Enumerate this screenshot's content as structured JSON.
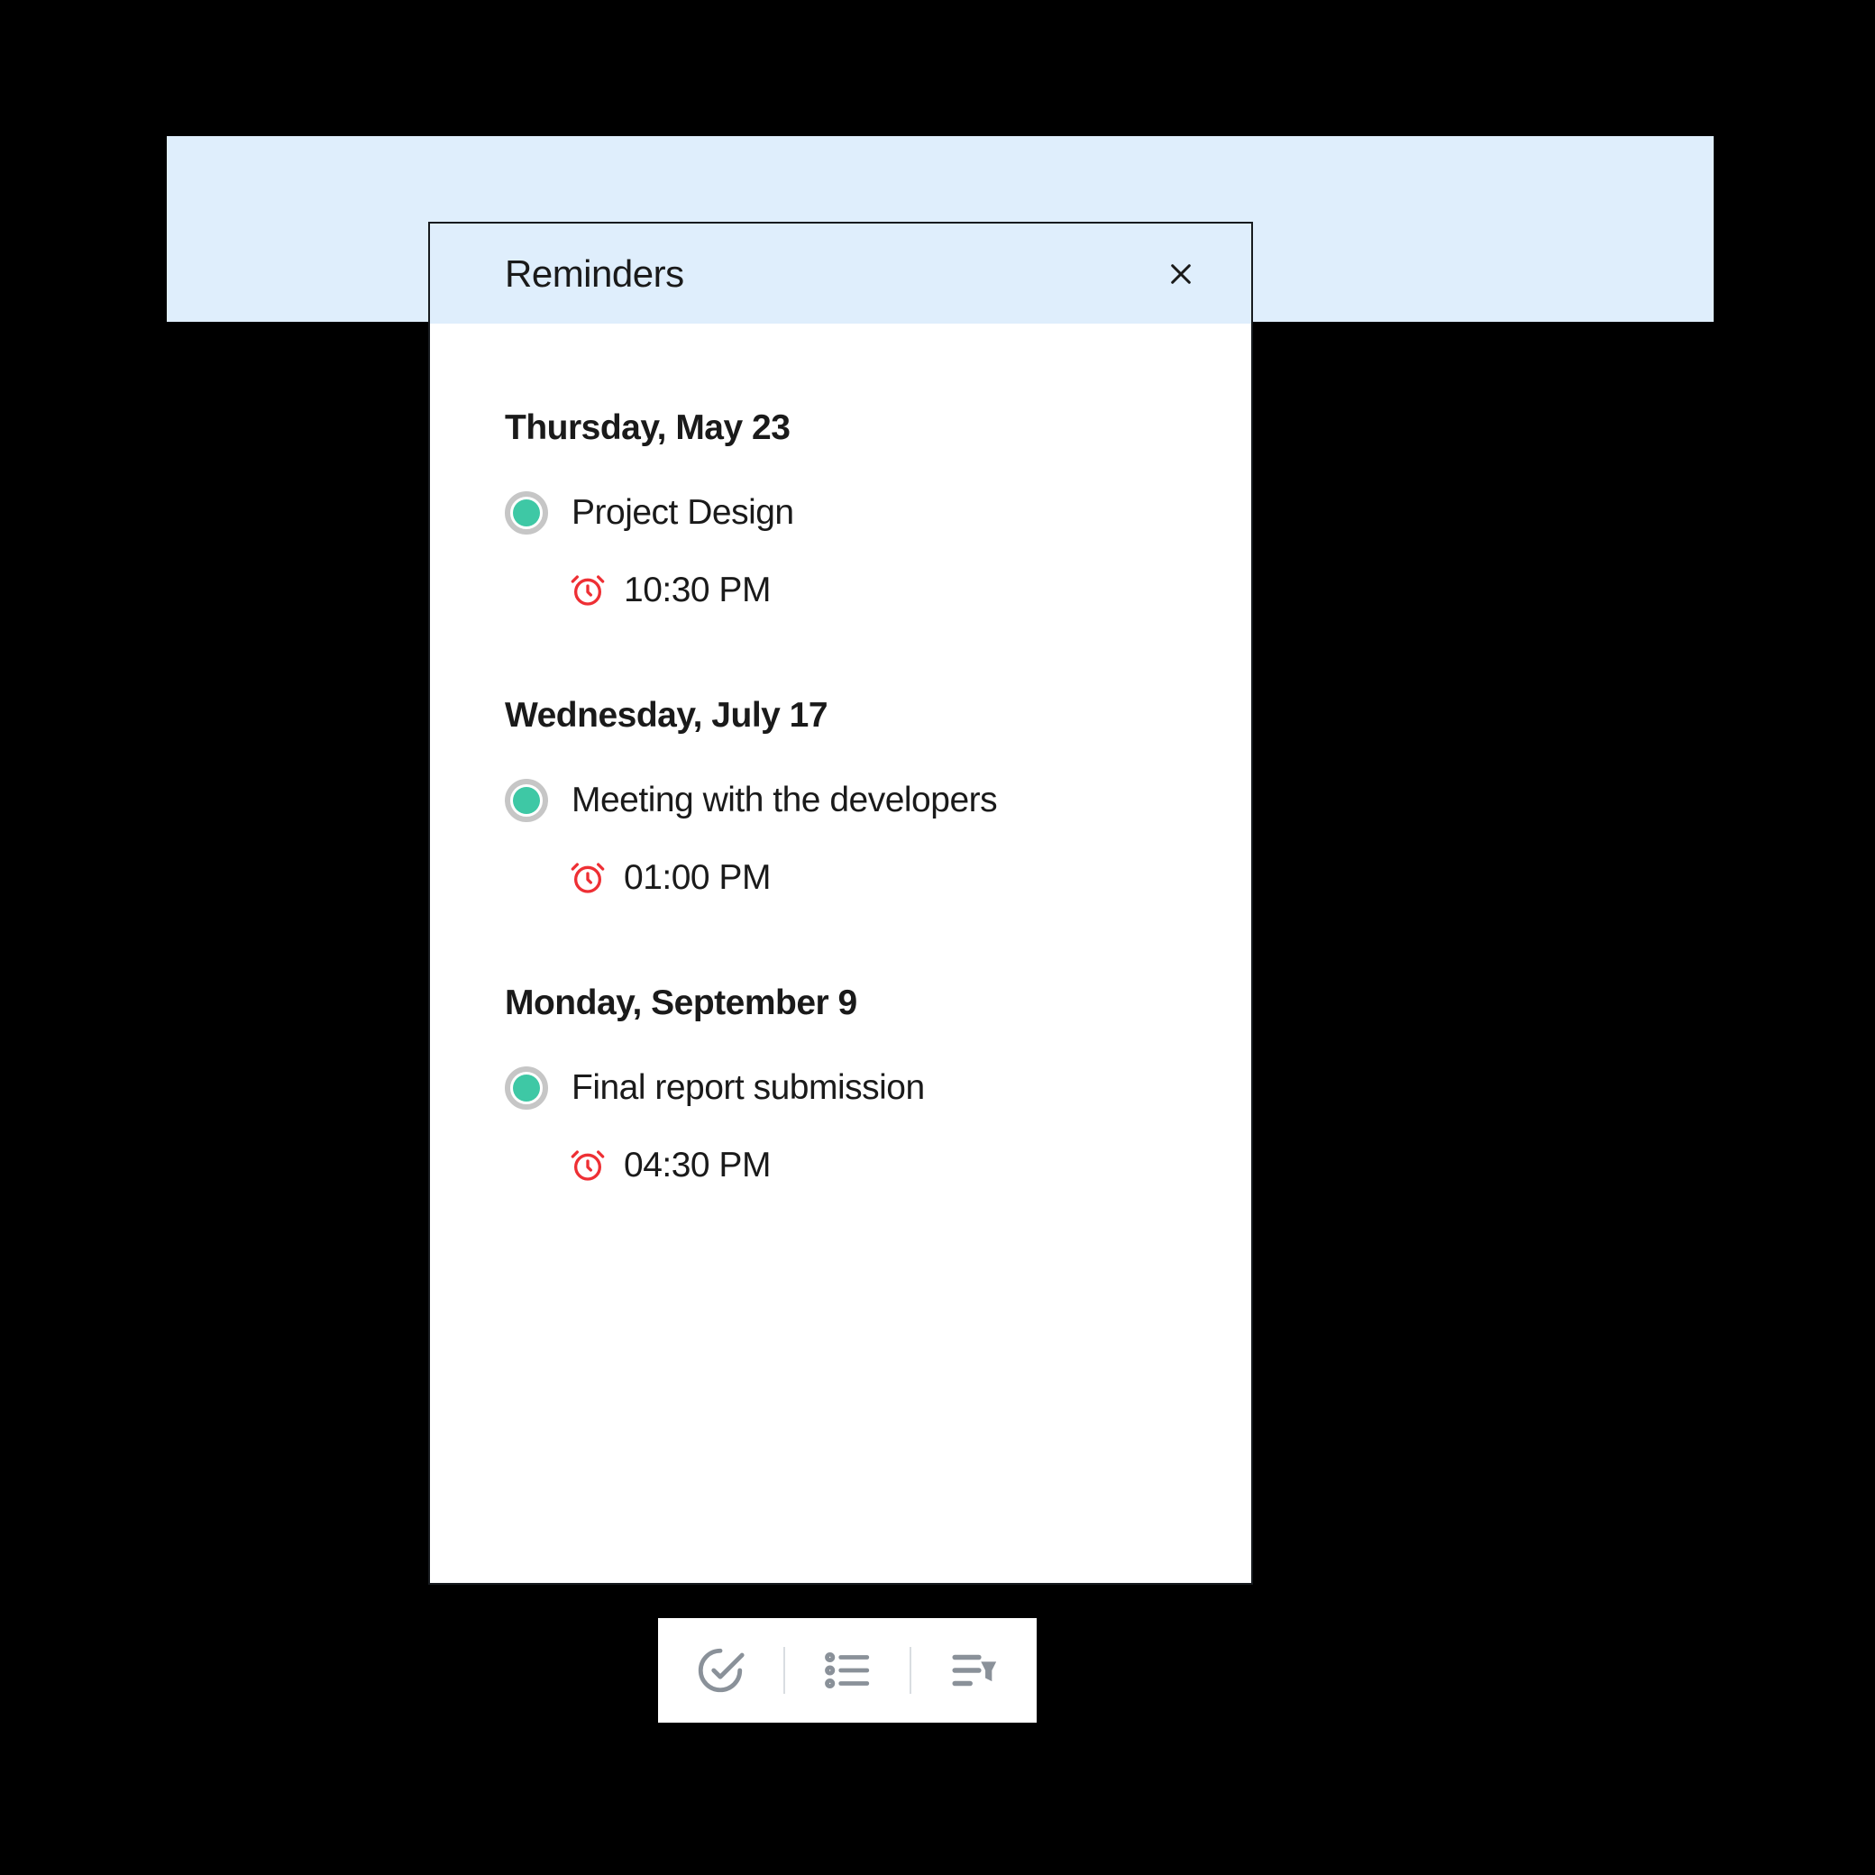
{
  "header": {
    "title": "Reminders"
  },
  "groups": [
    {
      "date": "Thursday, May 23",
      "items": [
        {
          "title": "Project Design",
          "time": "10:30 PM"
        }
      ]
    },
    {
      "date": "Wednesday, July 17",
      "items": [
        {
          "title": "Meeting with the developers",
          "time": "01:00 PM"
        }
      ]
    },
    {
      "date": "Monday, September 9",
      "items": [
        {
          "title": "Final report submission",
          "time": "04:30 PM"
        }
      ]
    }
  ],
  "colors": {
    "panel_header_bg": "#dfeefc",
    "accent_green": "#3ec8a5",
    "alarm_red": "#ee2f34",
    "toolbar_icon": "#8a9199"
  }
}
